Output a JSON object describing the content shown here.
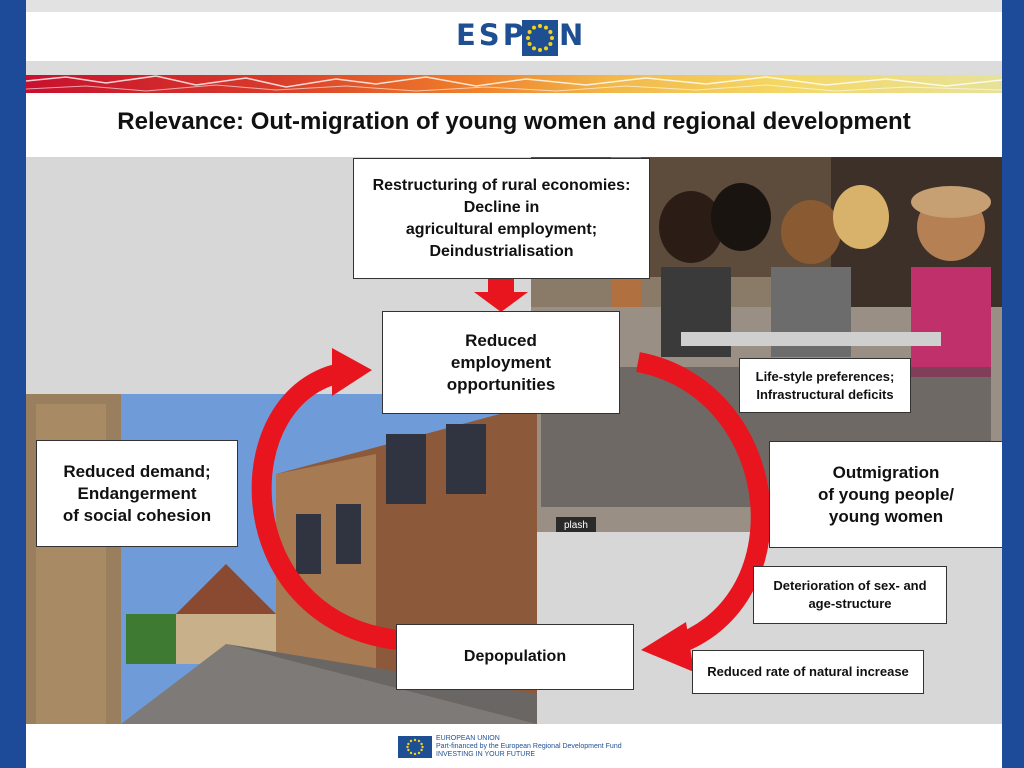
{
  "brand": {
    "logo_left": "ESP",
    "logo_right": "N"
  },
  "title": "Relevance: Out-migration of young women and regional development",
  "boxes": {
    "restructuring": "Restructuring of rural economies:\nDecline in\nagricultural employment;\nDeindustrialisation",
    "reduced_employment": "Reduced\nemployment\nopportunities",
    "lifestyle": "Life-style preferences;\nInfrastructural deficits",
    "reduced_demand": "Reduced demand;\nEndangerment\nof social cohesion",
    "outmigration": "Outmigration\nof young people/\nyoung women",
    "deterioration": "Deterioration of sex- and\nage-structure",
    "depopulation": "Depopulation",
    "natural_increase": "Reduced rate of natural increase"
  },
  "photo_watermark": "plash",
  "footer": {
    "eu_text": "EUROPEAN UNION\nPart-financed by the European Regional Development Fund\nINVESTING IN YOUR FUTURE"
  },
  "colors": {
    "brand_blue": "#1f4f93",
    "arrow_red": "#e8141e",
    "border_blue": "#1e4a9a"
  }
}
